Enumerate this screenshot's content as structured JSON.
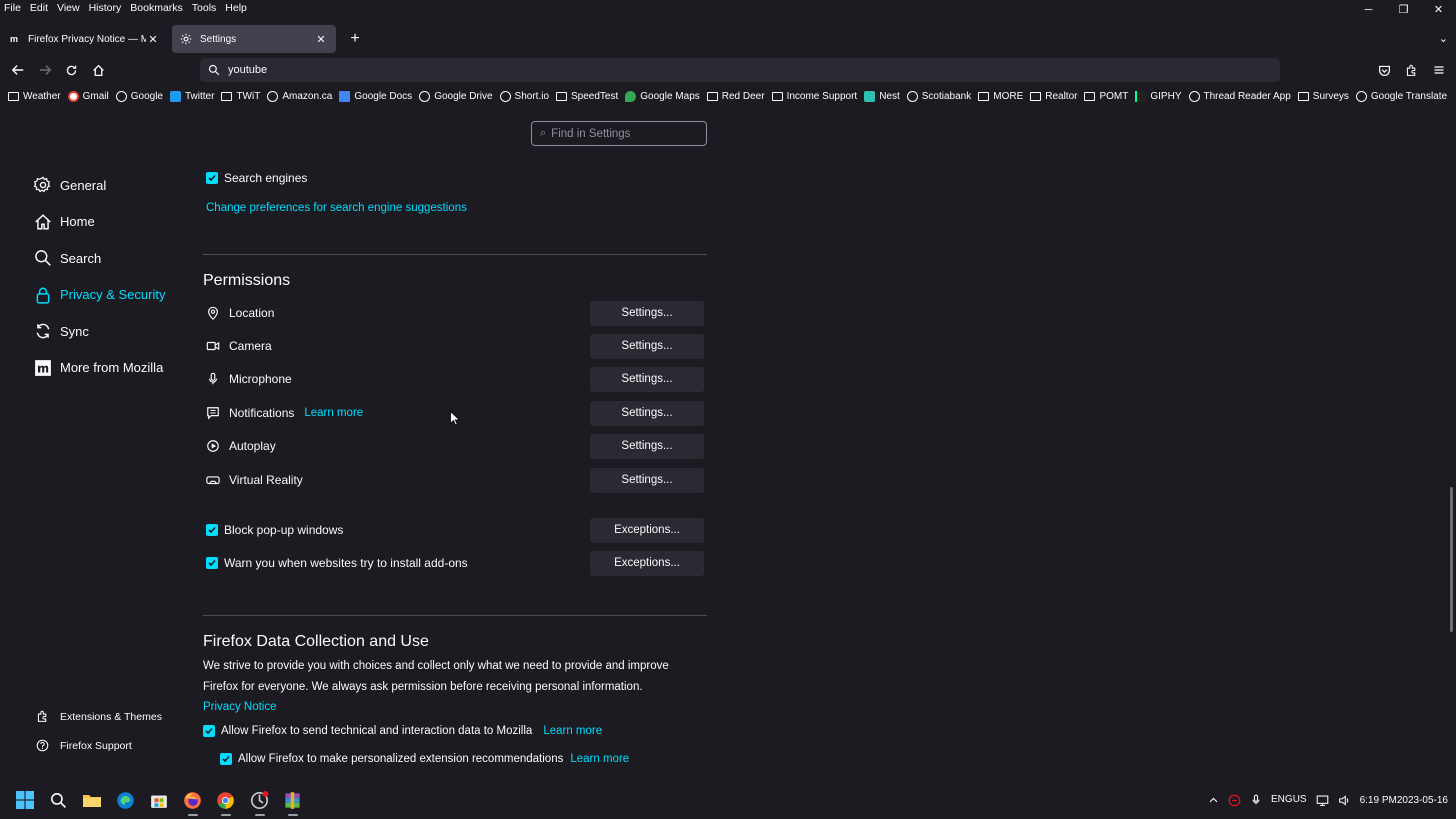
{
  "menubar": {
    "items": [
      "File",
      "Edit",
      "View",
      "History",
      "Bookmarks",
      "Tools",
      "Help"
    ]
  },
  "window_controls": {
    "minimize": "─",
    "restore": "❐",
    "close": "✕"
  },
  "tabs": [
    {
      "title": "Firefox Privacy Notice — Mozill",
      "icon": "mozilla-icon"
    },
    {
      "title": "Settings",
      "icon": "gear-icon"
    }
  ],
  "new_tab": "+",
  "urlbar": {
    "value": "youtube"
  },
  "bookmarks": [
    {
      "label": "Weather",
      "icon": "folder"
    },
    {
      "label": "Gmail",
      "icon": "gmail"
    },
    {
      "label": "Google",
      "icon": "globe"
    },
    {
      "label": "Twitter",
      "icon": "tw"
    },
    {
      "label": "TWiT",
      "icon": "folder"
    },
    {
      "label": "Amazon.ca",
      "icon": "globe"
    },
    {
      "label": "Google Docs",
      "icon": "docs"
    },
    {
      "label": "Google Drive",
      "icon": "globe"
    },
    {
      "label": "Short.io",
      "icon": "globe"
    },
    {
      "label": "SpeedTest",
      "icon": "folder"
    },
    {
      "label": "Google Maps",
      "icon": "maps"
    },
    {
      "label": "Red Deer",
      "icon": "folder"
    },
    {
      "label": "Income Support",
      "icon": "folder"
    },
    {
      "label": "Nest",
      "icon": "nest"
    },
    {
      "label": "Scotiabank",
      "icon": "globe"
    },
    {
      "label": "MORE",
      "icon": "folder"
    },
    {
      "label": "Realtor",
      "icon": "folder"
    },
    {
      "label": "POMT",
      "icon": "folder"
    },
    {
      "label": "GIPHY",
      "icon": "giphy"
    },
    {
      "label": "Thread Reader App",
      "icon": "globe"
    },
    {
      "label": "Surveys",
      "icon": "folder"
    },
    {
      "label": "Google Translate",
      "icon": "globe"
    }
  ],
  "search_settings": {
    "placeholder": "Find in Settings"
  },
  "sidebar": {
    "items": [
      {
        "label": "General",
        "icon": "gear-icon"
      },
      {
        "label": "Home",
        "icon": "home-icon"
      },
      {
        "label": "Search",
        "icon": "search-icon"
      },
      {
        "label": "Privacy & Security",
        "icon": "lock-icon",
        "selected": true
      },
      {
        "label": "Sync",
        "icon": "sync-icon"
      },
      {
        "label": "More from Mozilla",
        "icon": "mozilla-icon"
      }
    ],
    "bottom": [
      {
        "label": "Extensions & Themes",
        "icon": "puzzle-icon"
      },
      {
        "label": "Firefox Support",
        "icon": "help-icon"
      }
    ]
  },
  "main": {
    "search_engines_label": "Search engines",
    "change_prefs_link": "Change preferences for search engine suggestions",
    "permissions_heading": "Permissions",
    "permissions": [
      {
        "label": "Location",
        "icon": "location-icon",
        "button": "Settings..."
      },
      {
        "label": "Camera",
        "icon": "camera-icon",
        "button": "Settings..."
      },
      {
        "label": "Microphone",
        "icon": "microphone-icon",
        "button": "Settings..."
      },
      {
        "label": "Notifications",
        "icon": "notifications-icon",
        "button": "Settings...",
        "link": "Learn more"
      },
      {
        "label": "Autoplay",
        "icon": "autoplay-icon",
        "button": "Settings..."
      },
      {
        "label": "Virtual Reality",
        "icon": "vr-icon",
        "button": "Settings..."
      }
    ],
    "block_popups_label": "Block pop-up windows",
    "block_popups_button": "Exceptions...",
    "warn_addons_label": "Warn you when websites try to install add-ons",
    "warn_addons_button": "Exceptions...",
    "data_heading": "Firefox Data Collection and Use",
    "data_para_line1": "We strive to provide you with choices and collect only what we need to provide and improve",
    "data_para_line2": "Firefox for everyone. We always ask permission before receiving personal information.",
    "privacy_notice_link": "Privacy Notice",
    "allow_technical_label": "Allow Firefox to send technical and interaction data to Mozilla",
    "allow_technical_link": "Learn more",
    "allow_recommendations_label": "Allow Firefox to make personalized extension recommendations",
    "allow_recommendations_link": "Learn more"
  },
  "taskbar": {
    "tray": {
      "lang_top": "ENG",
      "lang_bottom": "US",
      "time": "6:19 PM",
      "date": "2023-05-16"
    }
  },
  "colors": {
    "accent": "#00ddff",
    "background": "#1c1b22",
    "button": "#2b2a33"
  }
}
